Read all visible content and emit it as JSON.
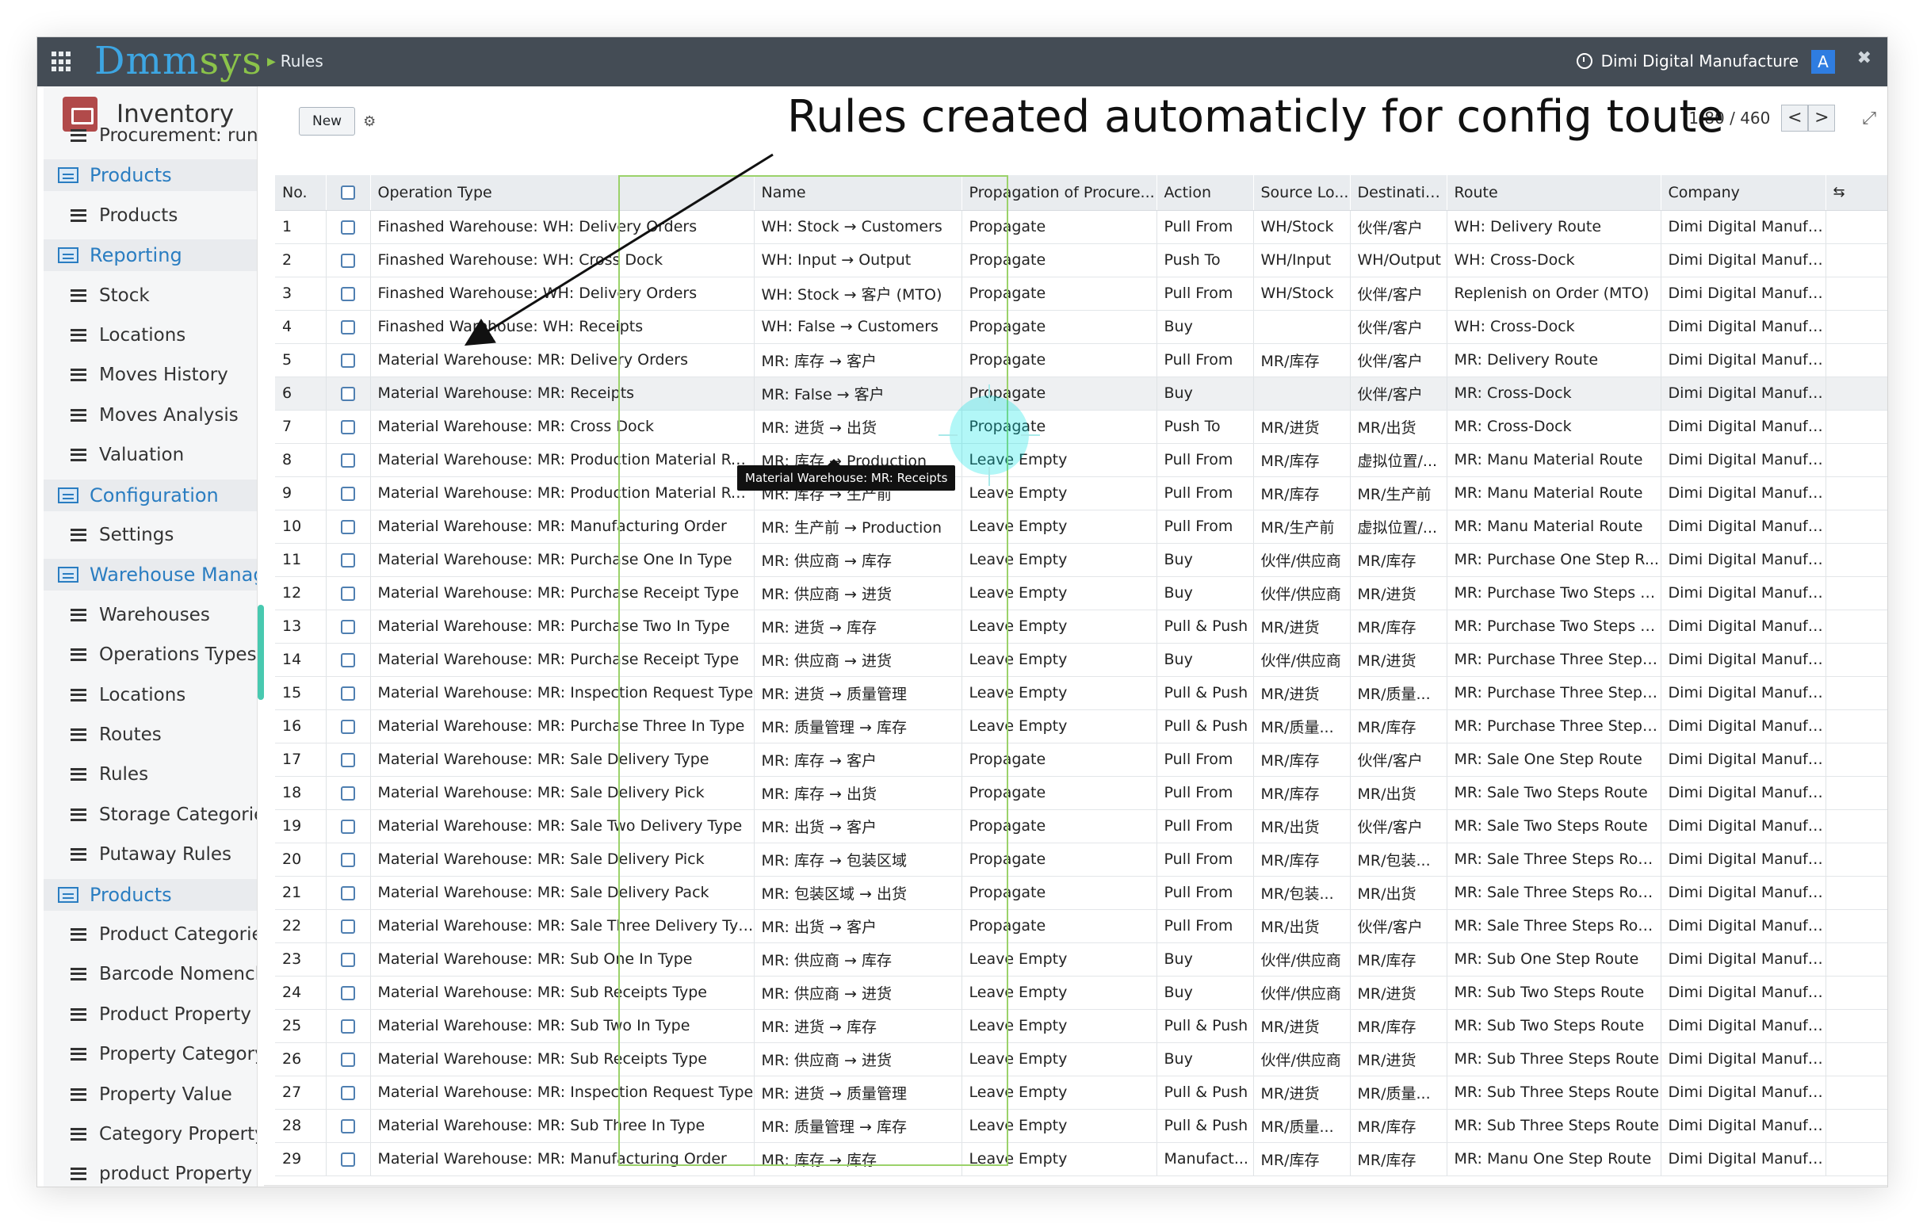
{
  "topbar": {
    "logo_main": "Dmm",
    "logo_accent": "sys",
    "breadcrumb": "Rules",
    "company": "Dimi Digital Manufacture",
    "avatar_letter": "A",
    "icons": [
      "apps-grid-icon",
      "company-clock-icon",
      "close-icon"
    ]
  },
  "sidebar": {
    "app_name": "Inventory",
    "items": [
      {
        "label": "Procurement: run",
        "type": "item"
      },
      {
        "label": "Products",
        "type": "section"
      },
      {
        "label": "Products",
        "type": "item"
      },
      {
        "label": "Reporting",
        "type": "section"
      },
      {
        "label": "Stock",
        "type": "item"
      },
      {
        "label": "Locations",
        "type": "item"
      },
      {
        "label": "Moves History",
        "type": "item"
      },
      {
        "label": "Moves Analysis",
        "type": "item"
      },
      {
        "label": "Valuation",
        "type": "item"
      },
      {
        "label": "Configuration",
        "type": "section"
      },
      {
        "label": "Settings",
        "type": "item"
      },
      {
        "label": "Warehouse Management",
        "type": "section"
      },
      {
        "label": "Warehouses",
        "type": "item"
      },
      {
        "label": "Operations Types",
        "type": "item"
      },
      {
        "label": "Locations",
        "type": "item"
      },
      {
        "label": "Routes",
        "type": "item"
      },
      {
        "label": "Rules",
        "type": "item"
      },
      {
        "label": "Storage Categories",
        "type": "item"
      },
      {
        "label": "Putaway Rules",
        "type": "item"
      },
      {
        "label": "Products",
        "type": "section"
      },
      {
        "label": "Product Categories",
        "type": "item"
      },
      {
        "label": "Barcode Nomenclatures",
        "type": "item"
      },
      {
        "label": "Product Property",
        "type": "item"
      },
      {
        "label": "Property Category",
        "type": "item"
      },
      {
        "label": "Property Value",
        "type": "item"
      },
      {
        "label": "Category Property",
        "type": "item"
      },
      {
        "label": "product Property",
        "type": "item"
      }
    ]
  },
  "toolbar": {
    "new_label": "New",
    "pager": "1-80 / 460",
    "prev": "<",
    "next": ">",
    "expand": "⤢"
  },
  "annotation": "Rules created automaticly for config toute",
  "tooltip": "Material Warehouse: MR: Receipts",
  "table": {
    "columns": [
      "No.",
      "",
      "Operation Type",
      "Name",
      "Propagation of Procure...",
      "Action",
      "Source Lo...",
      "Destinatio...",
      "Route",
      "Company",
      "⇆"
    ],
    "rows": [
      [
        "1",
        "Finashed Warehouse: WH: Delivery Orders",
        "WH: Stock → Customers",
        "Propagate",
        "Pull From",
        "WH/Stock",
        "伙伴/客户",
        "WH: Delivery Route",
        "Dimi Digital Manufacture"
      ],
      [
        "2",
        "Finashed Warehouse: WH: Cross Dock",
        "WH: Input → Output",
        "Propagate",
        "Push To",
        "WH/Input",
        "WH/Output",
        "WH: Cross-Dock",
        "Dimi Digital Manufacture"
      ],
      [
        "3",
        "Finashed Warehouse: WH: Delivery Orders",
        "WH: Stock → 客户 (MTO)",
        "Propagate",
        "Pull From",
        "WH/Stock",
        "伙伴/客户",
        "Replenish on Order (MTO)",
        "Dimi Digital Manufacture"
      ],
      [
        "4",
        "Finashed Warehouse: WH: Receipts",
        "WH: False → Customers",
        "Propagate",
        "Buy",
        "",
        "伙伴/客户",
        "WH: Cross-Dock",
        "Dimi Digital Manufacture"
      ],
      [
        "5",
        "Material Warehouse: MR: Delivery Orders",
        "MR: 库存 → 客户",
        "Propagate",
        "Pull From",
        "MR/库存",
        "伙伴/客户",
        "MR: Delivery Route",
        "Dimi Digital Manufacture"
      ],
      [
        "6",
        "Material Warehouse: MR: Receipts",
        "MR: False → 客户",
        "Propagate",
        "Buy",
        "",
        "伙伴/客户",
        "MR: Cross-Dock",
        "Dimi Digital Manufacture"
      ],
      [
        "7",
        "Material Warehouse: MR: Cross Dock",
        "MR: 进货 → 出货",
        "Propagate",
        "Push To",
        "MR/进货",
        "MR/出货",
        "MR: Cross-Dock",
        "Dimi Digital Manufacture"
      ],
      [
        "8",
        "Material Warehouse: MR: Production Material Re...",
        "MR: 库存 → Production",
        "Leave Empty",
        "Pull From",
        "MR/库存",
        "虚拟位置/...",
        "MR: Manu Material Route",
        "Dimi Digital Manufacture"
      ],
      [
        "9",
        "Material Warehouse: MR: Production Material Re...",
        "MR: 库存 → 生产前",
        "Leave Empty",
        "Pull From",
        "MR/库存",
        "MR/生产前",
        "MR: Manu Material Route",
        "Dimi Digital Manufacture"
      ],
      [
        "10",
        "Material Warehouse: MR: Manufacturing Order",
        "MR: 生产前 → Production",
        "Leave Empty",
        "Pull From",
        "MR/生产前",
        "虚拟位置/...",
        "MR: Manu Material Route",
        "Dimi Digital Manufacture"
      ],
      [
        "11",
        "Material Warehouse: MR: Purchase One In Type",
        "MR: 供应商 → 库存",
        "Leave Empty",
        "Buy",
        "伙伴/供应商",
        "MR/库存",
        "MR: Purchase One Step R...",
        "Dimi Digital Manufacture"
      ],
      [
        "12",
        "Material Warehouse: MR: Purchase Receipt Type",
        "MR: 供应商 → 进货",
        "Leave Empty",
        "Buy",
        "伙伴/供应商",
        "MR/进货",
        "MR: Purchase Two Steps R...",
        "Dimi Digital Manufacture"
      ],
      [
        "13",
        "Material Warehouse: MR: Purchase Two In Type",
        "MR: 进货 → 库存",
        "Leave Empty",
        "Pull & Push",
        "MR/进货",
        "MR/库存",
        "MR: Purchase Two Steps R...",
        "Dimi Digital Manufacture"
      ],
      [
        "14",
        "Material Warehouse: MR: Purchase Receipt Type",
        "MR: 供应商 → 进货",
        "Leave Empty",
        "Buy",
        "伙伴/供应商",
        "MR/进货",
        "MR: Purchase Three Steps ...",
        "Dimi Digital Manufacture"
      ],
      [
        "15",
        "Material Warehouse: MR: Inspection Request Type",
        "MR: 进货 → 质量管理",
        "Leave Empty",
        "Pull & Push",
        "MR/进货",
        "MR/质量...",
        "MR: Purchase Three Steps ...",
        "Dimi Digital Manufacture"
      ],
      [
        "16",
        "Material Warehouse: MR: Purchase Three In Type",
        "MR: 质量管理 → 库存",
        "Leave Empty",
        "Pull & Push",
        "MR/质量...",
        "MR/库存",
        "MR: Purchase Three Steps ...",
        "Dimi Digital Manufacture"
      ],
      [
        "17",
        "Material Warehouse: MR: Sale Delivery Type",
        "MR: 库存 → 客户",
        "Propagate",
        "Pull From",
        "MR/库存",
        "伙伴/客户",
        "MR: Sale One Step Route",
        "Dimi Digital Manufacture"
      ],
      [
        "18",
        "Material Warehouse: MR: Sale Delivery Pick",
        "MR: 库存 → 出货",
        "Propagate",
        "Pull From",
        "MR/库存",
        "MR/出货",
        "MR: Sale Two Steps Route",
        "Dimi Digital Manufacture"
      ],
      [
        "19",
        "Material Warehouse: MR: Sale Two Delivery Type",
        "MR: 出货 → 客户",
        "Propagate",
        "Pull From",
        "MR/出货",
        "伙伴/客户",
        "MR: Sale Two Steps Route",
        "Dimi Digital Manufacture"
      ],
      [
        "20",
        "Material Warehouse: MR: Sale Delivery Pick",
        "MR: 库存 → 包装区域",
        "Propagate",
        "Pull From",
        "MR/库存",
        "MR/包装...",
        "MR: Sale Three Steps Route",
        "Dimi Digital Manufacture"
      ],
      [
        "21",
        "Material Warehouse: MR: Sale Delivery Pack",
        "MR: 包装区域 → 出货",
        "Propagate",
        "Pull From",
        "MR/包装...",
        "MR/出货",
        "MR: Sale Three Steps Route",
        "Dimi Digital Manufacture"
      ],
      [
        "22",
        "Material Warehouse: MR: Sale Three Delivery Type",
        "MR: 出货 → 客户",
        "Propagate",
        "Pull From",
        "MR/出货",
        "伙伴/客户",
        "MR: Sale Three Steps Route",
        "Dimi Digital Manufacture"
      ],
      [
        "23",
        "Material Warehouse: MR: Sub One In Type",
        "MR: 供应商 → 库存",
        "Leave Empty",
        "Buy",
        "伙伴/供应商",
        "MR/库存",
        "MR: Sub One Step Route",
        "Dimi Digital Manufacture"
      ],
      [
        "24",
        "Material Warehouse: MR: Sub Receipts Type",
        "MR: 供应商 → 进货",
        "Leave Empty",
        "Buy",
        "伙伴/供应商",
        "MR/进货",
        "MR: Sub Two Steps Route",
        "Dimi Digital Manufacture"
      ],
      [
        "25",
        "Material Warehouse: MR: Sub Two In Type",
        "MR: 进货 → 库存",
        "Leave Empty",
        "Pull & Push",
        "MR/进货",
        "MR/库存",
        "MR: Sub Two Steps Route",
        "Dimi Digital Manufacture"
      ],
      [
        "26",
        "Material Warehouse: MR: Sub Receipts Type",
        "MR: 供应商 → 进货",
        "Leave Empty",
        "Buy",
        "伙伴/供应商",
        "MR/进货",
        "MR: Sub Three Steps Route",
        "Dimi Digital Manufacture"
      ],
      [
        "27",
        "Material Warehouse: MR: Inspection Request Type",
        "MR: 进货 → 质量管理",
        "Leave Empty",
        "Pull & Push",
        "MR/进货",
        "MR/质量...",
        "MR: Sub Three Steps Route",
        "Dimi Digital Manufacture"
      ],
      [
        "28",
        "Material Warehouse: MR: Sub Three In Type",
        "MR: 质量管理 → 库存",
        "Leave Empty",
        "Pull & Push",
        "MR/质量...",
        "MR/库存",
        "MR: Sub Three Steps Route",
        "Dimi Digital Manufacture"
      ],
      [
        "29",
        "Material Warehouse: MR: Manufacturing Order",
        "MR: 库存 → 库存",
        "Leave Empty",
        "Manufact...",
        "MR/库存",
        "MR/库存",
        "MR: Manu One Step Route",
        "Dimi Digital Manufacture"
      ]
    ]
  },
  "colors": {
    "topbar": "#444c55",
    "logo": "#3da6e3",
    "logo_accent": "#8bc34a",
    "highlight_box": "#9bd26a",
    "sidebar_section": "#2a7dc1"
  }
}
